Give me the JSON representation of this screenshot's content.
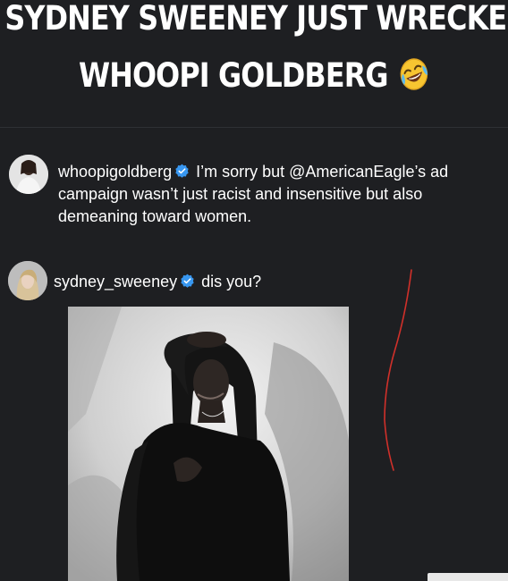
{
  "headline": {
    "line1": "SYDNEY SWEENEY JUST WRECKED",
    "line2": "WHOOPI GOLDBERG",
    "emoji": "rolling-on-floor-laughing-emoji"
  },
  "comments": [
    {
      "username": "whoopigoldberg",
      "verified": true,
      "text": "I’m sorry but @AmericanEagle’s ad campaign wasn’t just racist and insensitive but also demeaning toward women."
    },
    {
      "username": "sydney_sweeney",
      "verified": true,
      "text": "dis you?"
    }
  ],
  "colors": {
    "background": "#1e1f22",
    "text": "#ffffff",
    "verified": "#3897f0",
    "annotation": "#d0302a"
  },
  "icons": {
    "verified": "verified-badge-icon",
    "annotation": "red-marker-line"
  }
}
